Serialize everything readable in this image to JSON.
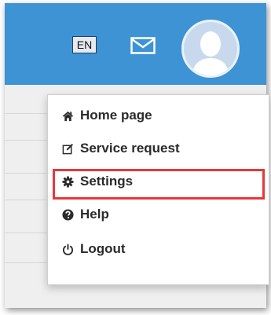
{
  "header": {
    "language": "EN"
  },
  "menu": {
    "items": [
      {
        "label": "Home page",
        "icon": "home-icon"
      },
      {
        "label": "Service request",
        "icon": "edit-icon"
      },
      {
        "label": "Settings",
        "icon": "gear-icon"
      },
      {
        "label": "Help",
        "icon": "help-icon"
      },
      {
        "label": "Logout",
        "icon": "power-icon"
      }
    ],
    "highlighted_item": "Settings"
  },
  "colors": {
    "header_bg": "#3d93d3",
    "highlight": "#e8373a",
    "menu_text": "#2a2a2a"
  }
}
